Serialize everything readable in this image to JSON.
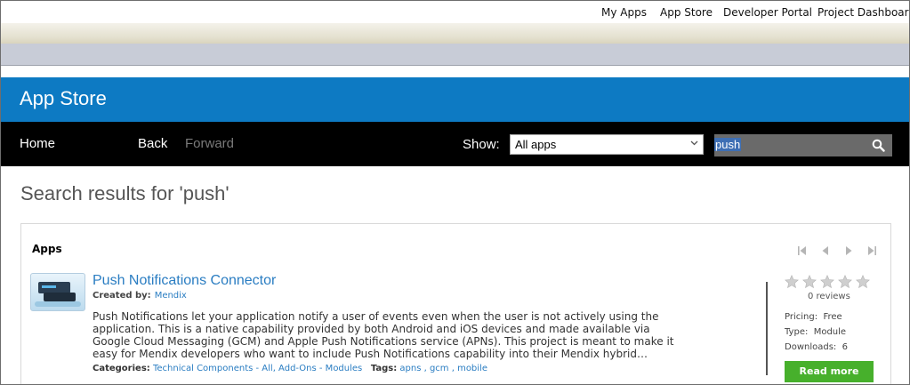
{
  "topnav": {
    "items": [
      "My Apps",
      "App Store",
      "Developer Portal",
      "Project Dashboard"
    ]
  },
  "header": {
    "title": "App Store"
  },
  "toolbar": {
    "home": "Home",
    "back": "Back",
    "forward": "Forward",
    "show_label": "Show:",
    "filter_value": "All apps",
    "search_value": "push"
  },
  "results": {
    "title": "Search results for 'push'",
    "section_title": "Apps",
    "app": {
      "name": "Push Notifications Connector",
      "created_by_label": "Created by:",
      "creator": "Mendix",
      "description": "Push Notifications let your application notify a user of events even when the user is not actively using the application. This is a native capability provided by both Android and iOS devices and made available via Google Cloud Messaging (GCM) and Apple Push Notifications service (APNs). This project is meant to make it easy for Mendix developers who want to include Push Notifications capability into their Mendix hybrid…",
      "categories_label": "Categories:",
      "categories": "Technical Components - All, Add-Ons - Modules",
      "tags_label": "Tags:",
      "tags": "apns , gcm , mobile",
      "rating_stars": 0,
      "reviews": "0 reviews",
      "pricing_label": "Pricing:",
      "pricing": "Free",
      "type_label": "Type:",
      "type": "Module",
      "downloads_label": "Downloads:",
      "downloads": "6",
      "read_more": "Read more"
    }
  },
  "colors": {
    "header_blue": "#0d7ac3",
    "toolbar_black": "#000000",
    "link_blue": "#2a7dc2",
    "button_green": "#47b02c"
  }
}
